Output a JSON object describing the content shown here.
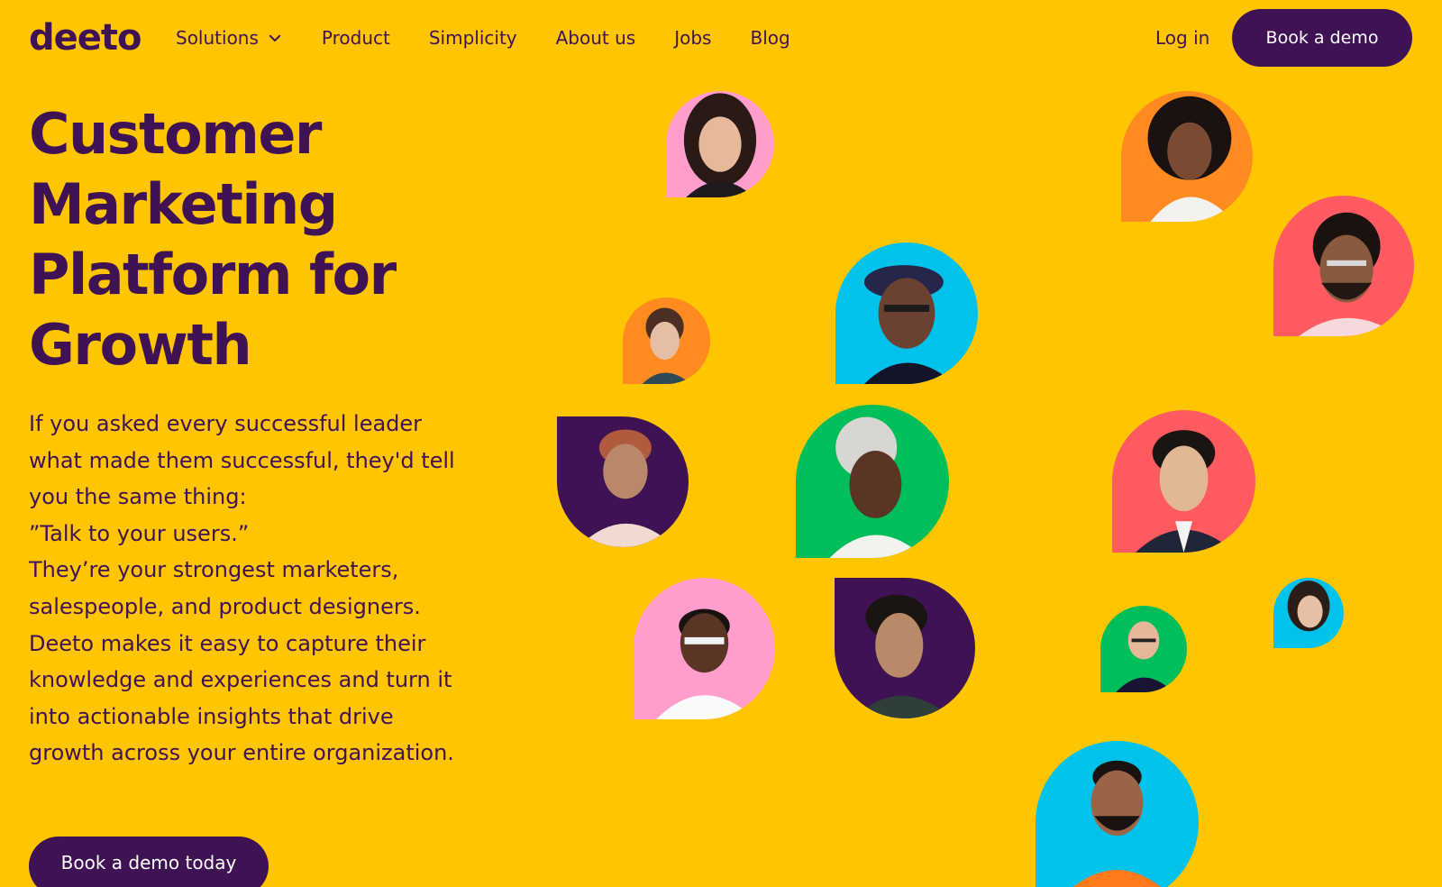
{
  "nav": {
    "logo": "deeto",
    "links": [
      "Solutions",
      "Product",
      "Simplicity",
      "About us",
      "Jobs",
      "Blog"
    ],
    "login": "Log in",
    "cta": "Book a demo"
  },
  "hero": {
    "title": "Customer Marketing Platform for Growth",
    "body": [
      "If you asked every successful leader what made them successful, they'd tell you the same thing:",
      "”Talk to your users.”",
      "They’re your strongest marketers, salespeople, and product designers. Deeto makes it easy to capture their knowledge and experiences and turn it into actionable insights that drive growth across your entire organization."
    ],
    "cta": "Book a demo today"
  },
  "colors": {
    "background": "#FFC500",
    "brand": "#3F1254",
    "pink": "#FF9ECD",
    "orange": "#FF8A1F",
    "blue": "#00C2EA",
    "green": "#00BE5A",
    "red": "#FF5A5F",
    "purple": "#3F1254"
  },
  "avatars": [
    {
      "name": "avatar-woman-dark-hair",
      "bg": "pink"
    },
    {
      "name": "avatar-woman-curly-hair",
      "bg": "orange"
    },
    {
      "name": "avatar-man-beard-glasses",
      "bg": "red"
    },
    {
      "name": "avatar-man-beret-glasses",
      "bg": "blue"
    },
    {
      "name": "avatar-woman-short-hair",
      "bg": "orange"
    },
    {
      "name": "avatar-man-beanie",
      "bg": "purple"
    },
    {
      "name": "avatar-woman-braids",
      "bg": "green"
    },
    {
      "name": "avatar-man-suit",
      "bg": "red"
    },
    {
      "name": "avatar-woman-glasses-smile",
      "bg": "pink"
    },
    {
      "name": "avatar-man-looking-side",
      "bg": "purple"
    },
    {
      "name": "avatar-man-bald-glasses",
      "bg": "green"
    },
    {
      "name": "avatar-woman-smiling",
      "bg": "blue"
    },
    {
      "name": "avatar-man-orange-sweater",
      "bg": "blue"
    }
  ]
}
